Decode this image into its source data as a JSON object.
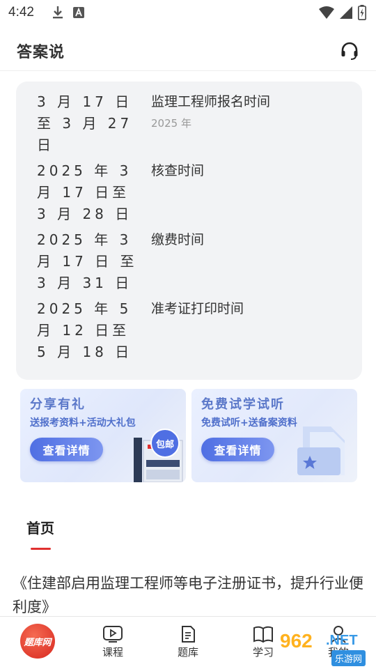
{
  "status_bar": {
    "time": "4:42"
  },
  "header": {
    "title": "答案说"
  },
  "schedule": [
    {
      "date": "3 月 17 日至 3 月 27 日",
      "event": "监理工程师报名时间",
      "year": "2025 年"
    },
    {
      "date": "2025 年 3 月 17 日至 3 月 28 日",
      "event": "核查时间",
      "year": ""
    },
    {
      "date": "2025 年 3 月 17 日 至 3 月 31 日",
      "event": "缴费时间",
      "year": ""
    },
    {
      "date": "2025 年 5 月 12 日至 5 月 18 日",
      "event": "准考证打印时间",
      "year": ""
    }
  ],
  "banners": [
    {
      "title": "分享有礼",
      "subtitle": "送报考资料+活动大礼包",
      "button": "查看详情",
      "badge": "包邮"
    },
    {
      "title": "免费试学试听",
      "subtitle": "免费试听+送备案资料",
      "button": "查看详情"
    }
  ],
  "tabs": {
    "home": "首页"
  },
  "article": {
    "title": "《住建部启用监理工程师等电子注册证书，提升行业便利度》"
  },
  "bottom_nav": {
    "logo_text": "题库网",
    "items": [
      {
        "label": "课程",
        "icon": "play-icon"
      },
      {
        "label": "题库",
        "icon": "document-icon"
      },
      {
        "label": "学习",
        "icon": "book-icon"
      },
      {
        "label": "我的",
        "icon": "user-icon"
      }
    ]
  },
  "watermark": {
    "number": "962",
    "net": ".NET",
    "site": "乐游网"
  },
  "colors": {
    "accent_red": "#e0302f",
    "banner_blue": "#4f6fe3",
    "card_bg": "#f2f3f5"
  }
}
